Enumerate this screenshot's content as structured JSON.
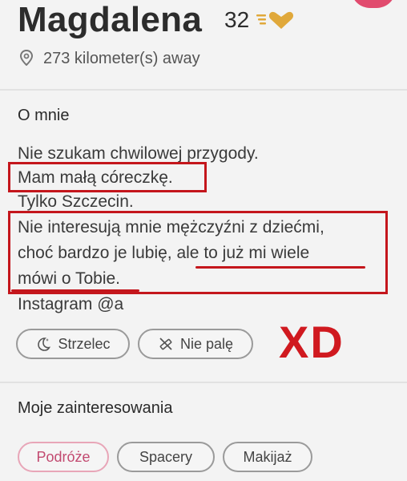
{
  "profile": {
    "name": "Magdalena",
    "age": "32",
    "distance": "273 kilometer(s) away"
  },
  "about": {
    "title": "O mnie",
    "lines": [
      "Nie szukam chwilowej przygody.",
      "Mam małą córeczkę.",
      "Tylko Szczecin.",
      "Nie interesują mnie mężczyźni z dziećmi,",
      "choć bardzo je lubię, ale to już mi wiele",
      "mówi o Tobie.",
      "Instagram @a"
    ]
  },
  "tags": {
    "zodiac": "Strzelec",
    "smoking": "Nie palę"
  },
  "overlay": {
    "reaction": "XD",
    "annotation_color": "#c4161c"
  },
  "interests": {
    "title": "Moje zainteresowania",
    "items": [
      "Podróże",
      "Spacery",
      "Makijaż"
    ]
  },
  "icons": {
    "verified": "gold-heart-badge-icon",
    "location": "location-pin-icon",
    "zodiac": "moon-stars-icon",
    "smoking": "no-smoking-icon"
  },
  "colors": {
    "brand_pink": "#e14b6e",
    "gold": "#e0a83a"
  }
}
